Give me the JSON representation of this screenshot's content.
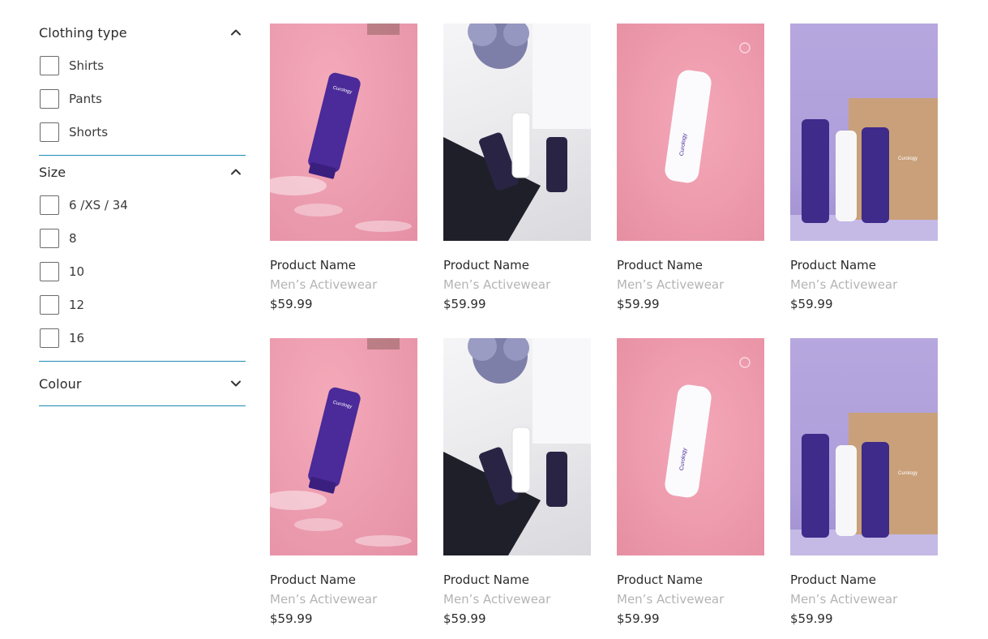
{
  "filters": [
    {
      "title": "Clothing type",
      "expanded": true,
      "options": [
        "Shirts",
        "Pants",
        "Shorts"
      ]
    },
    {
      "title": "Size",
      "expanded": true,
      "options": [
        "6 /XS / 34",
        "8",
        "10",
        "12",
        "16"
      ]
    },
    {
      "title": "Colour",
      "expanded": false,
      "options": []
    }
  ],
  "colors": {
    "divider": "#1f8ab5",
    "muted_text": "#b4b4b4",
    "text": "#2b2b2b"
  },
  "products": [
    {
      "name": "Product Name",
      "category": "Men’s Activewear",
      "price": "$59.99",
      "image": "pink-water-tube"
    },
    {
      "name": "Product Name",
      "category": "Men’s Activewear",
      "price": "$59.99",
      "image": "flatlay-flowers"
    },
    {
      "name": "Product Name",
      "category": "Men’s Activewear",
      "price": "$59.99",
      "image": "pink-water-bottle"
    },
    {
      "name": "Product Name",
      "category": "Men’s Activewear",
      "price": "$59.99",
      "image": "lavender-box-set"
    },
    {
      "name": "Product Name",
      "category": "Men’s Activewear",
      "price": "$59.99",
      "image": "pink-water-tube"
    },
    {
      "name": "Product Name",
      "category": "Men’s Activewear",
      "price": "$59.99",
      "image": "flatlay-flowers"
    },
    {
      "name": "Product Name",
      "category": "Men’s Activewear",
      "price": "$59.99",
      "image": "pink-water-bottle"
    },
    {
      "name": "Product Name",
      "category": "Men’s Activewear",
      "price": "$59.99",
      "image": "lavender-box-set"
    }
  ],
  "brand_on_products": "Curology"
}
